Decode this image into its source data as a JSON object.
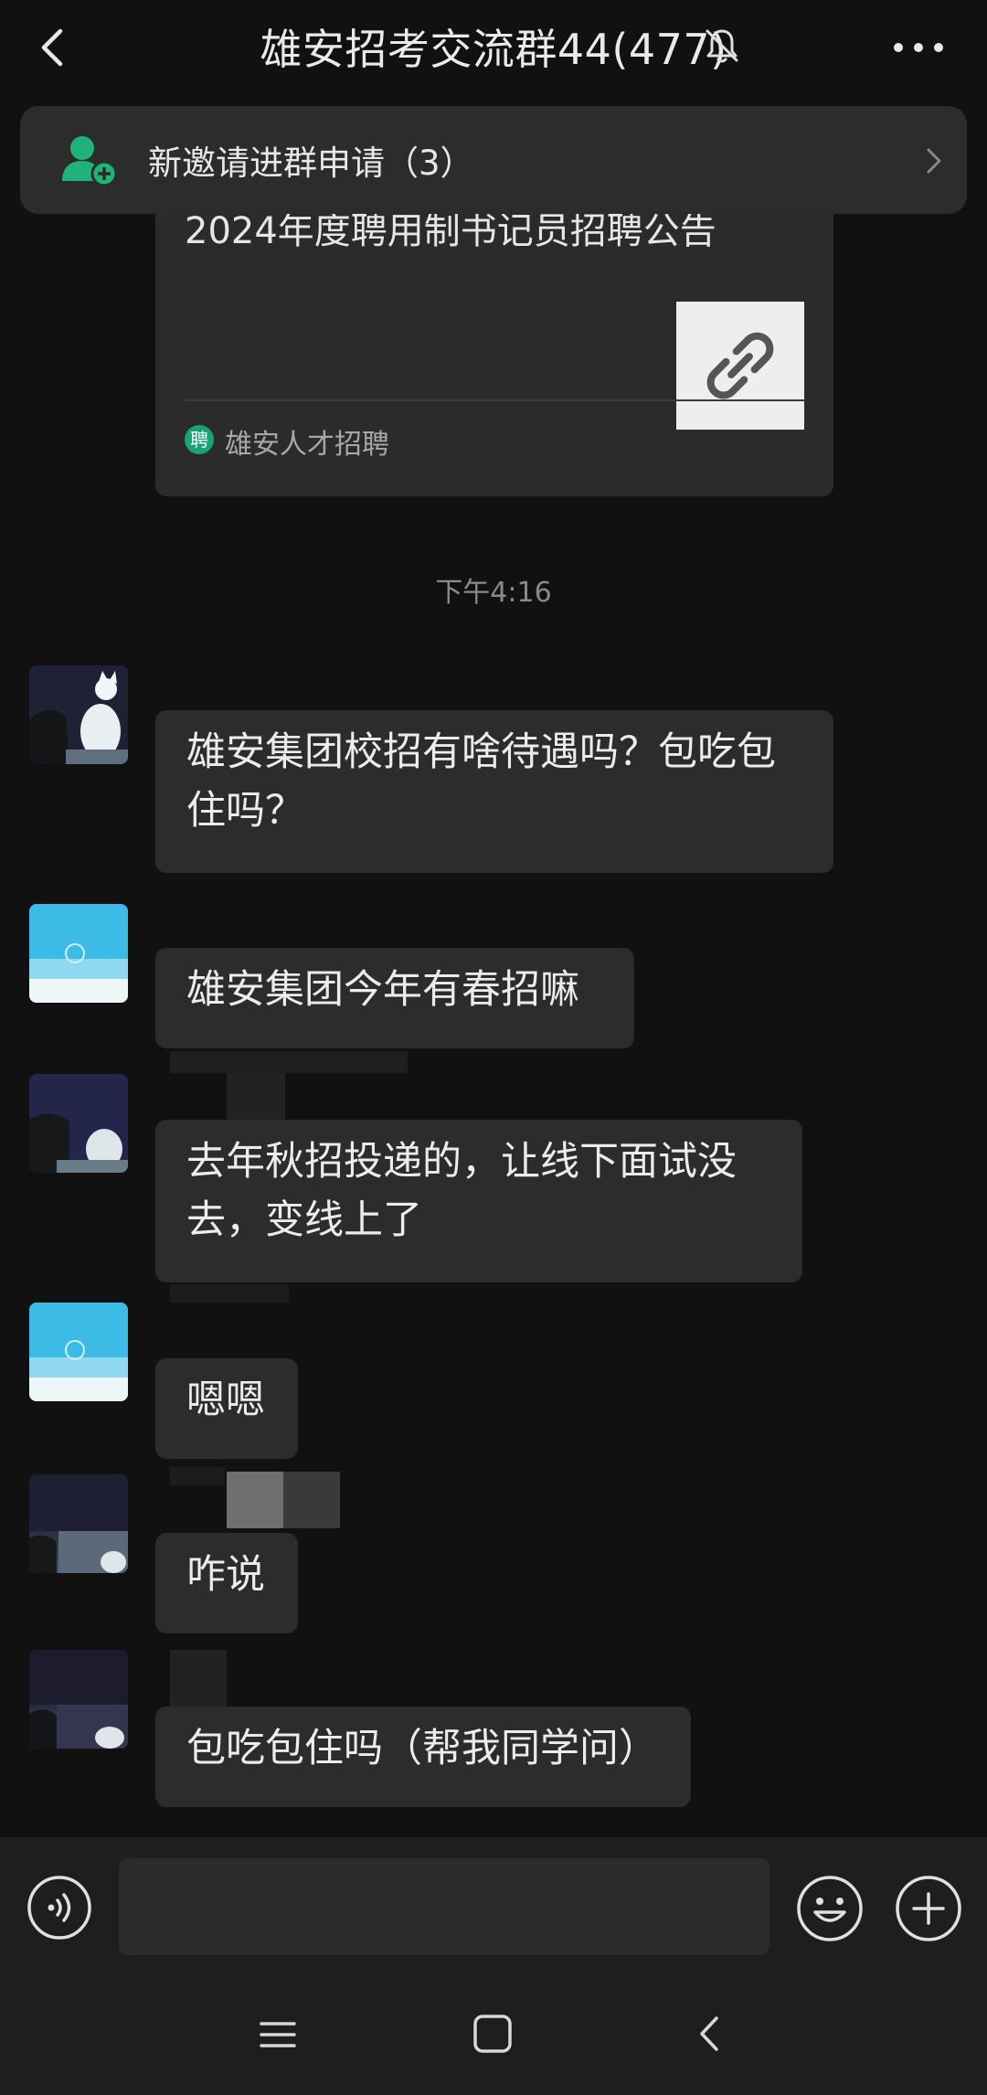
{
  "header": {
    "title": "雄安招考交流群44(477)",
    "back_icon": "chevron-left-icon",
    "mute_icon": "bell-off-icon",
    "more_icon": "more-dots-icon"
  },
  "invite_banner": {
    "text": "新邀请进群申请（3）",
    "icon": "add-member-icon"
  },
  "link_card": {
    "title": "2024年度聘用制书记员招聘公告",
    "thumbnail_icon": "link-icon",
    "source_icon_text": "聘",
    "source": "雄安人才招聘"
  },
  "timestamp": "下午4:16",
  "messages": [
    {
      "avatar": "cat-avatar",
      "lines": [
        "雄安集团校招有啥待遇吗？包吃包",
        "住吗？"
      ]
    },
    {
      "avatar": "sea-avatar",
      "lines": [
        "雄安集团今年有春招嘛"
      ]
    },
    {
      "avatar": "cat-avatar",
      "lines": [
        "去年秋招投递的，让线下面试没",
        "去，变线上了"
      ]
    },
    {
      "avatar": "sea-avatar",
      "lines": [
        "嗯嗯"
      ]
    },
    {
      "avatar": "cat-avatar",
      "lines": [
        "咋说"
      ]
    },
    {
      "avatar": "cat-avatar",
      "lines": [
        "包吃包住吗（帮我同学问）"
      ]
    }
  ],
  "input": {
    "value": "",
    "placeholder": ""
  },
  "colors": {
    "background": "#111111",
    "bubble": "#2c2c2c",
    "accent_green": "#18a37a"
  }
}
